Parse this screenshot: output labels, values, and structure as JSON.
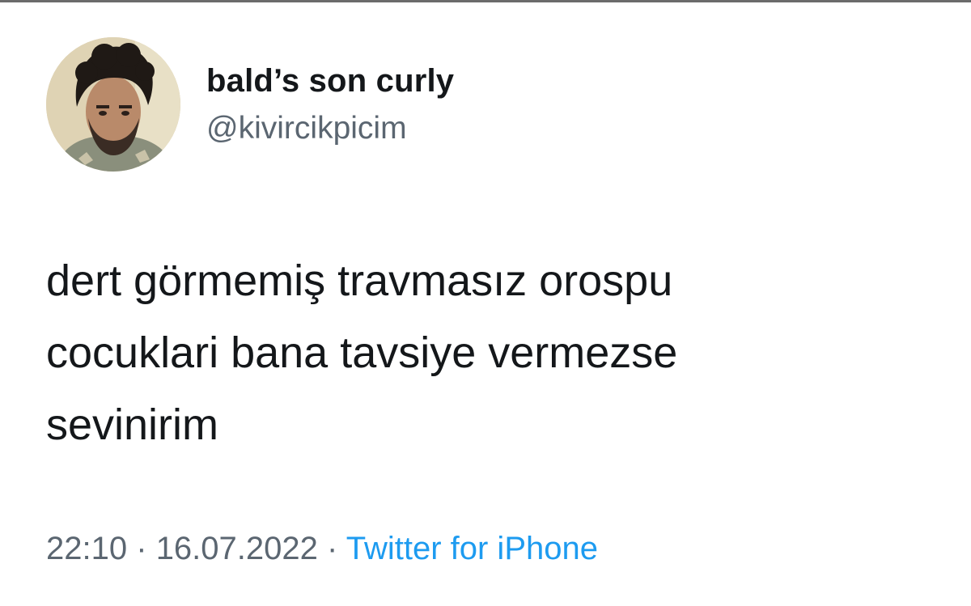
{
  "tweet": {
    "author": {
      "display_name": "bald’s son curly",
      "handle": "@kivircikpicim",
      "avatar_icon": "profile-photo"
    },
    "text_lines": [
      "dert görmemiş travmasız orospu",
      "cocuklari bana tavsiye vermezse",
      "sevinirim"
    ],
    "time": "22:10",
    "separator": "·",
    "date": "16.07.2022",
    "source": "Twitter for iPhone"
  },
  "colors": {
    "text": "#14171a",
    "secondary": "#5b6671",
    "link": "#1d9bf0",
    "background": "#ffffff"
  }
}
